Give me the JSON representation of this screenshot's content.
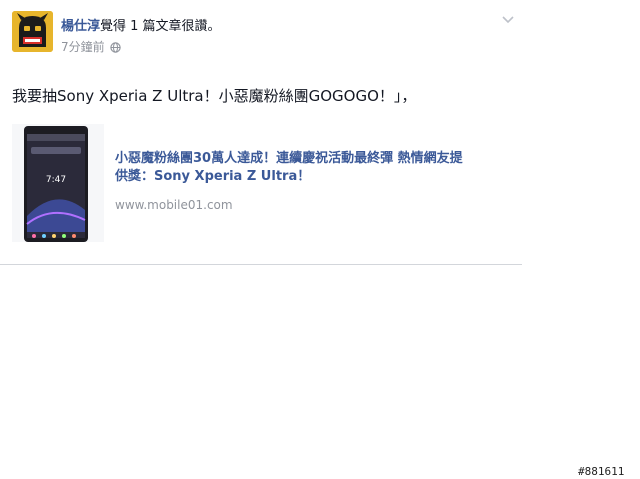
{
  "post": {
    "author": "楊仕淳",
    "action": "覺得 1 篇文章很讚。",
    "timestamp": "7分鐘前",
    "privacy_icon": "globe-icon",
    "menu_icon": "chevron-down-icon",
    "text": "我要抽Sony Xperia Z Ultra！小惡魔粉絲團GOGOGO！」，",
    "link": {
      "title": "小惡魔粉絲團30萬人達成！連續慶祝活動最終彈 熱情網友提供獎：Sony Xperia Z Ultra！",
      "domain": "www.mobile01.com",
      "phone_clock": "7:47"
    }
  },
  "watermark": "#881611",
  "colors": {
    "link_blue": "#3b5998",
    "meta_gray": "#90949c",
    "avatar_yellow": "#e7b52c"
  }
}
